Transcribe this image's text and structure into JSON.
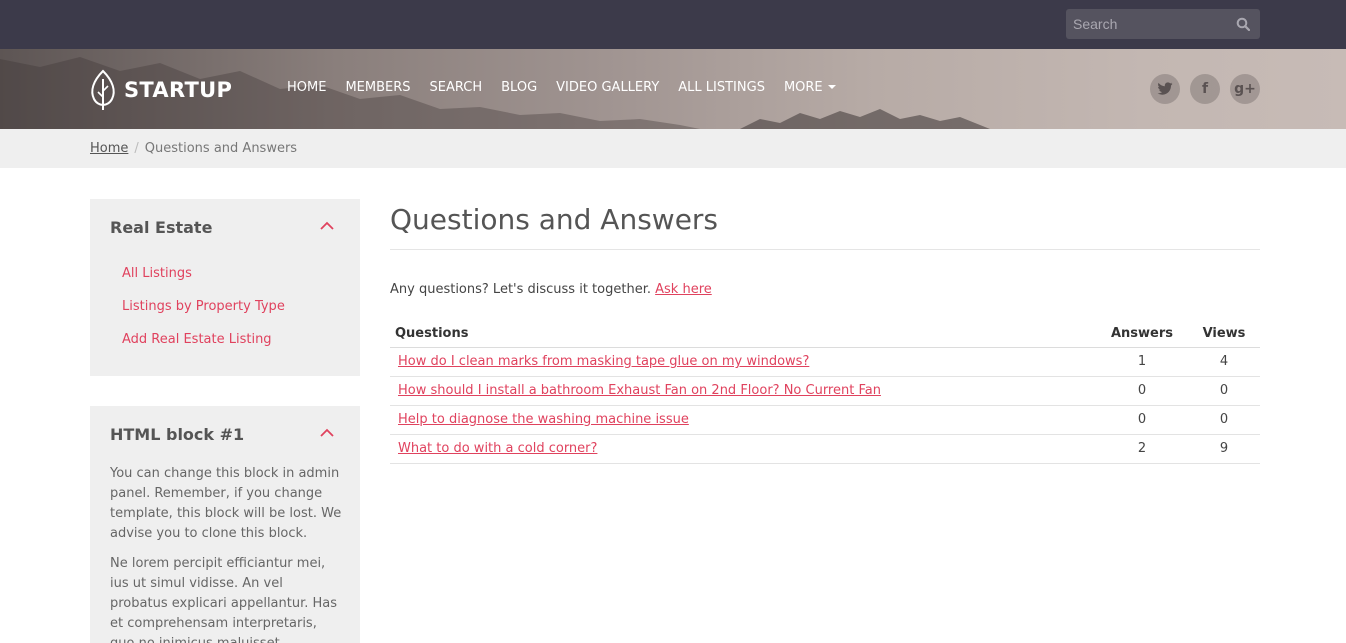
{
  "topbar": {
    "search_placeholder": "Search",
    "search_icon": "magnifier-icon"
  },
  "header": {
    "logo_text": "STARTUP",
    "logo_icon": "leaf-icon",
    "nav": [
      "HOME",
      "MEMBERS",
      "SEARCH",
      "BLOG",
      "VIDEO GALLERY",
      "ALL LISTINGS",
      "MORE"
    ],
    "social": [
      {
        "name": "twitter-icon",
        "glyph": "🐦"
      },
      {
        "name": "facebook-icon",
        "glyph": "f"
      },
      {
        "name": "google-plus-icon",
        "glyph": "g+"
      }
    ]
  },
  "breadcrumb": {
    "home": "Home",
    "separator": "/",
    "current": "Questions and Answers"
  },
  "sidebar": {
    "real_estate": {
      "title": "Real Estate",
      "links": [
        "All Listings",
        "Listings by Property Type",
        "Add Real Estate Listing"
      ]
    },
    "html_block": {
      "title": "HTML block #1",
      "para1": "You can change this block in admin panel. Remember, if you change template, this block will be lost. We advise you to clone this block.",
      "para2": "Ne lorem percipit efficiantur mei, ius ut simul vidisse. An vel probatus explicari appellantur. Has et comprehensam interpretaris, quo no inimicus maluisset temporibus. Ea"
    }
  },
  "main": {
    "title": "Questions and Answers",
    "intro_text": "Any questions? Let's discuss it together.",
    "ask_link": "Ask here",
    "table": {
      "headers": {
        "questions": "Questions",
        "answers": "Answers",
        "views": "Views"
      },
      "rows": [
        {
          "question": "How do I clean marks from masking tape glue on my windows?",
          "answers": "1",
          "views": "4"
        },
        {
          "question": "How should I install a bathroom Exhaust Fan on 2nd Floor? No Current Fan",
          "answers": "0",
          "views": "0"
        },
        {
          "question": "Help to diagnose the washing machine issue",
          "answers": "0",
          "views": "0"
        },
        {
          "question": "What to do with a cold corner?",
          "answers": "2",
          "views": "9"
        }
      ]
    }
  },
  "colors": {
    "accent": "#e0425e",
    "topbar": "#3c3a4a",
    "panel_bg": "#efefef"
  }
}
